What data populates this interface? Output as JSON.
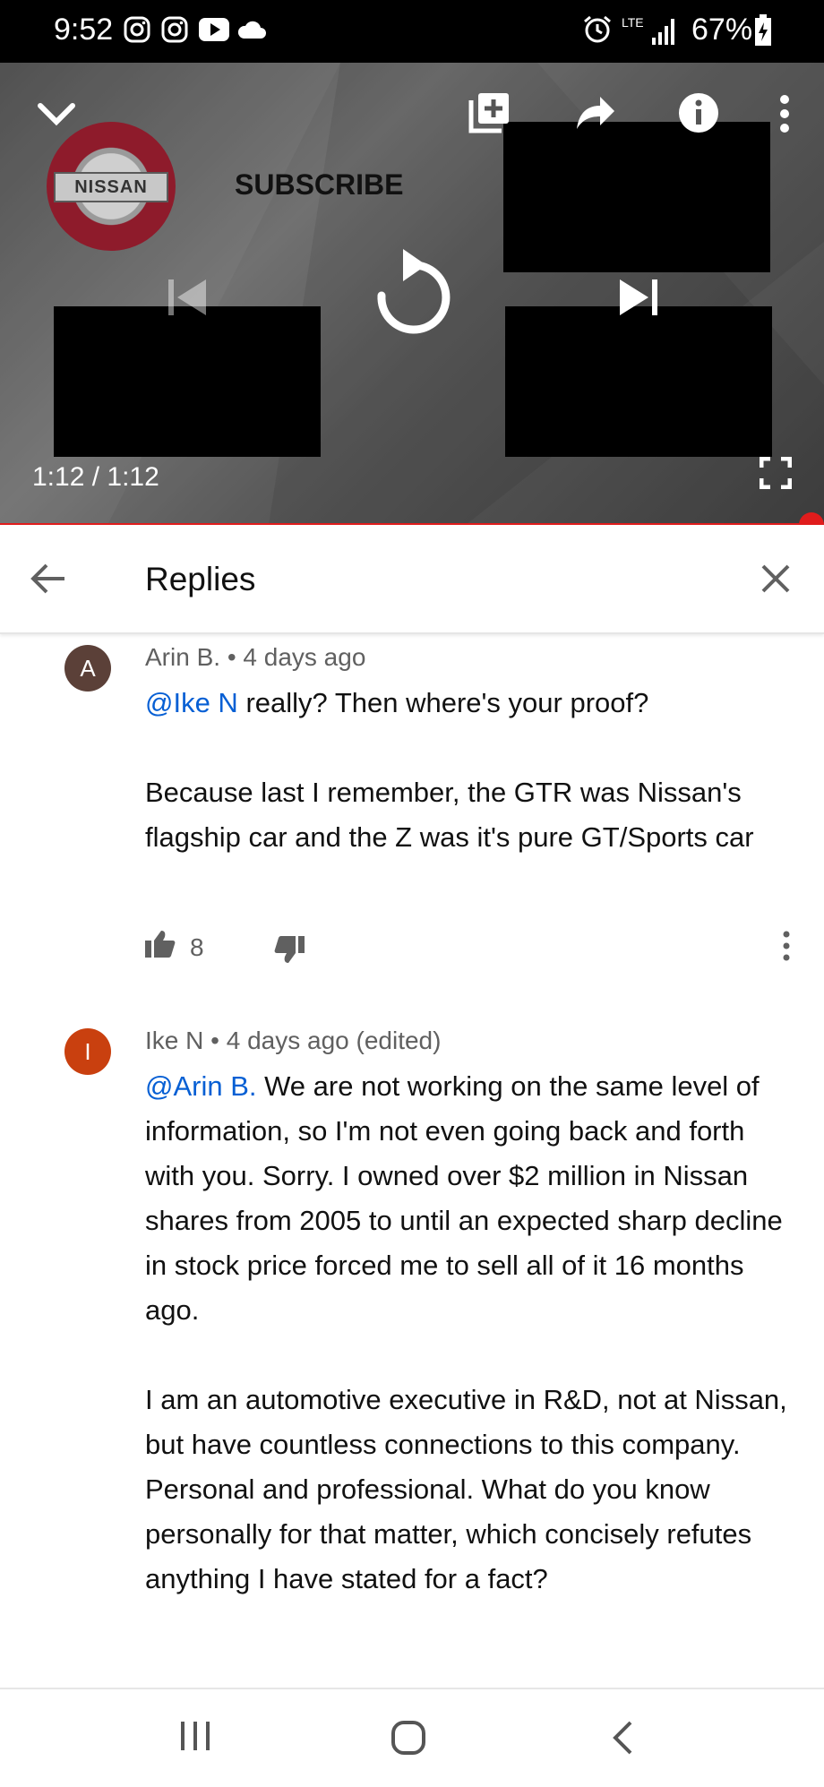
{
  "status_bar": {
    "time": "9:52",
    "left_icons": [
      "instagram-icon",
      "instagram-icon",
      "youtube-icon",
      "cloud-icon"
    ],
    "right_icons": [
      "alarm-icon",
      "lte-icon",
      "signal-icon"
    ],
    "network_label": "LTE",
    "battery": "67%"
  },
  "player": {
    "channel_logo_text": "NISSAN",
    "subscribe_label": "SUBSCRIBE",
    "time": "1:12 / 1:12",
    "progress": 1.0,
    "top_icons": [
      "chevron-down-icon",
      "add-to-playlist-icon",
      "share-icon",
      "info-icon",
      "more-vert-icon"
    ],
    "center_icons": [
      "previous-icon",
      "replay-icon",
      "next-icon"
    ],
    "accent": "#e01c1c"
  },
  "replies": {
    "title": "Replies",
    "back_icon": "arrow-back-icon",
    "close_icon": "close-icon"
  },
  "comments": [
    {
      "avatar_letter": "A",
      "avatar_color": "#5b4038",
      "author": "Arin B.",
      "separator": "•",
      "time": "4 days ago",
      "mention": "@Ike N",
      "first_line": " really? Then where's your proof?",
      "paragraph_2": "Because last I remember, the GTR was Nissan's flagship car and the Z was it's pure GT/Sports car",
      "likes": "8"
    },
    {
      "avatar_letter": "I",
      "avatar_color": "#c9400f",
      "author": "Ike N",
      "separator": "•",
      "time": "4 days ago (edited)",
      "mention": "@Arin B.",
      "first_line": " We are not working on the same level of information, so I'm not even going back and forth with you. Sorry. I owned over $2 million in Nissan shares from 2005 to until an expected sharp decline in stock price forced me to sell all of it 16 months ago.",
      "paragraph_2": "I am an automotive executive in R&D, not at Nissan, but have countless connections to this company. Personal and professional. What do you know personally for that matter, which concisely refutes anything I have stated for a fact?"
    }
  ],
  "nav_bar": {
    "icons": [
      "recent-apps-icon",
      "home-icon",
      "back-icon"
    ]
  }
}
